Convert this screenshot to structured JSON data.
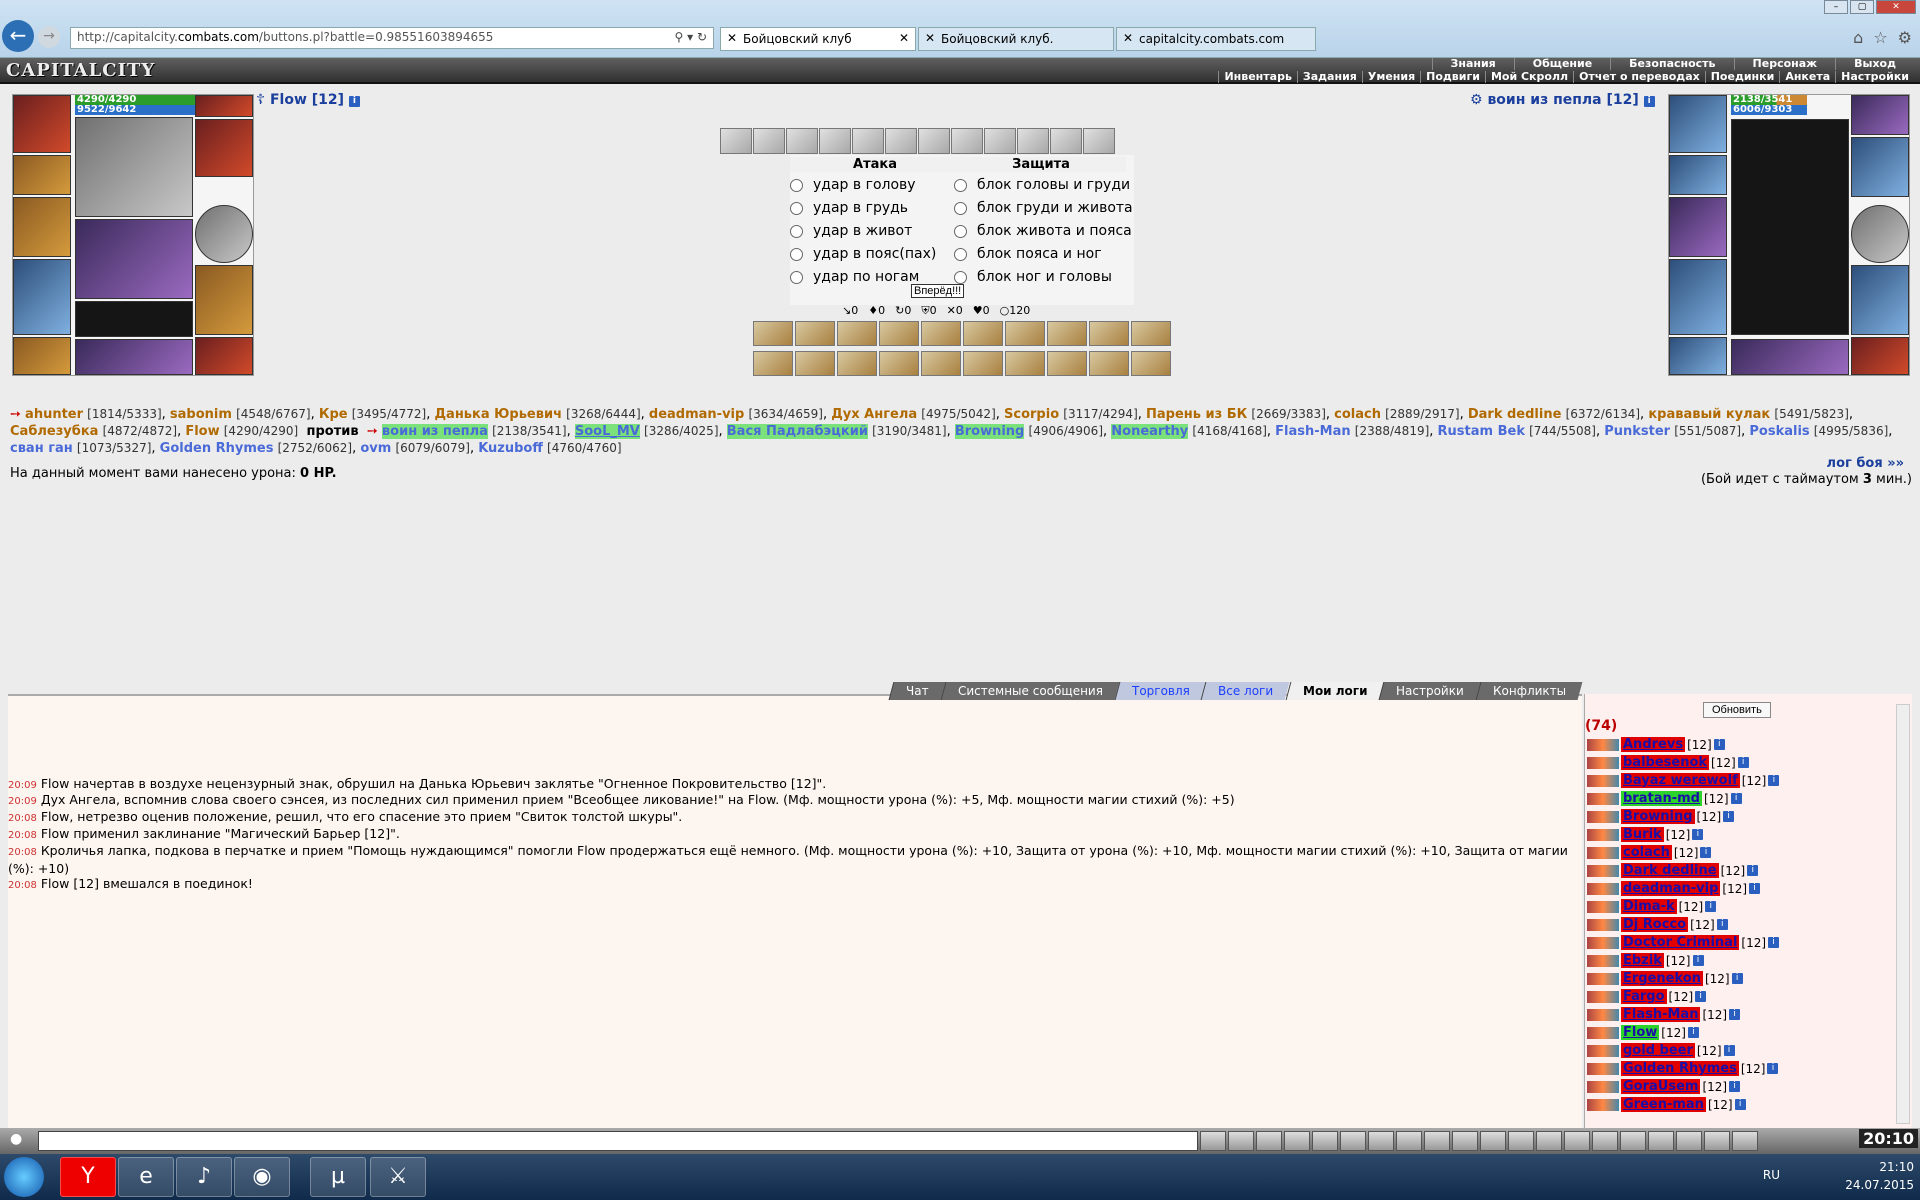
{
  "browser": {
    "url_prefix": "http://capitalcity.",
    "url_domain": "combats.com",
    "url_path": "/buttons.pl?battle=0.98551603894655",
    "tabs": [
      {
        "label": "Бойцовский клуб",
        "active": true
      },
      {
        "label": "Бойцовский клуб.",
        "active": false
      },
      {
        "label": "capitalcity.combats.com",
        "active": false
      }
    ]
  },
  "game": {
    "logo": "CAPITALCITY",
    "menu_top": [
      "Знания",
      "Общение",
      "Безопасность",
      "Персонаж",
      "Выход"
    ],
    "menu_bottom": [
      "Инвентарь",
      "Задания",
      "Умения",
      "Подвиги",
      "Мой Скролл",
      "Отчет о переводах",
      "Поединки",
      "Анкета",
      "Настройки"
    ],
    "player": {
      "name": "Flow",
      "level": "[12]",
      "hp": "4290/4290",
      "mp": "9522/9642"
    },
    "opponent": {
      "name": "воин из пепла",
      "level": "[12]",
      "hp": "2138/3541",
      "mp": "6006/9303"
    },
    "attack_title": "Атака",
    "defense_title": "Защита",
    "attacks": [
      "удар в голову",
      "удар в грудь",
      "удар в живот",
      "удар в пояс(пах)",
      "удар по ногам"
    ],
    "defenses": [
      "блок головы и груди",
      "блок груди и живота",
      "блок живота и пояса",
      "блок пояса и ног",
      "блок ног и головы"
    ],
    "forward_button": "Вперёд!!!",
    "stats": [
      "0",
      "0",
      "0",
      "0",
      "0",
      "0",
      "120"
    ],
    "team1": [
      {
        "name": "ahunter",
        "stat": "[1814/5333]"
      },
      {
        "name": "sabonim",
        "stat": "[4548/6767]"
      },
      {
        "name": "Кре",
        "stat": "[3495/4772]"
      },
      {
        "name": "Данька Юрьевич",
        "stat": "[3268/6444]"
      },
      {
        "name": "deadman-vip",
        "stat": "[3634/4659]"
      },
      {
        "name": "Дух Ангела",
        "stat": "[4975/5042]"
      },
      {
        "name": "Scorpio",
        "stat": "[3117/4294]"
      },
      {
        "name": "Парень из БК",
        "stat": "[2669/3383]"
      },
      {
        "name": "colach",
        "stat": "[2889/2917]"
      },
      {
        "name": "Dark dedline",
        "stat": "[6372/6134]"
      },
      {
        "name": "крававый кулак",
        "stat": "[5491/5823]"
      },
      {
        "name": "Саблезубка",
        "stat": "[4872/4872]"
      },
      {
        "name": "Flow",
        "stat": "[4290/4290]"
      }
    ],
    "versus": "против",
    "team2": [
      {
        "name": "воин из пепла",
        "stat": "[2138/3541]"
      },
      {
        "name": "SooL_MV",
        "stat": "[3286/4025]"
      },
      {
        "name": "Вася Падлабэцкий",
        "stat": "[3190/3481]"
      },
      {
        "name": "Browning",
        "stat": "[4906/4906]"
      },
      {
        "name": "Nonearthy",
        "stat": "[4168/4168]"
      },
      {
        "name": "Flash-Man",
        "stat": "[2388/4819]"
      },
      {
        "name": "Rustam Bek",
        "stat": "[744/5508]"
      },
      {
        "name": "Punkster",
        "stat": "[551/5087]"
      },
      {
        "name": "Poskalis",
        "stat": "[4995/5836]"
      },
      {
        "name": "сван ган",
        "stat": "[1073/5327]"
      },
      {
        "name": "Golden Rhymes",
        "stat": "[2752/6062]"
      },
      {
        "name": "ovm",
        "stat": "[6079/6079]"
      },
      {
        "name": "Kuzuboff",
        "stat": "[4760/4760]"
      }
    ],
    "damage_text": "На данный момент вами нанесено урона:",
    "damage_value": "0 HP.",
    "log_link": "лог боя »»",
    "timeout_pre": "(Бой идет с таймаутом ",
    "timeout_val": "3",
    "timeout_post": " мин.)"
  },
  "chat": {
    "tabs": [
      "Чат",
      "Системные сообщения",
      "Торговля",
      "Все логи",
      "Мои логи",
      "Настройки",
      "Конфликты"
    ],
    "messages": [
      {
        "time": "20:09",
        "text": "Flow начертав в воздухе нецензурный знак, обрушил на Данька Юрьевич заклятье \"Огненное Покровительство [12]\"."
      },
      {
        "time": "20:09",
        "text": "Дух Ангела, вспомнив слова своего сэнсея, из последних сил применил прием \"Всеобщее ликование!\" на Flow. (Мф. мощности урона (%): +5, Мф. мощности магии стихий (%): +5)"
      },
      {
        "time": "20:08",
        "text": "Flow, нетрезво оценив положение, решил, что его спасение это прием \"Свиток толстой шкуры\"."
      },
      {
        "time": "20:08",
        "text": "Flow применил заклинание \"Магический Барьер [12]\"."
      },
      {
        "time": "20:08",
        "text": "Кроличья лапка, подкова в перчатке и прием \"Помощь нуждающимся\" помогли Flow продержаться ещё немного. (Мф. мощности урона (%): +10, Защита от урона (%): +10, Мф. мощности магии стихий (%): +10, Защита от магии (%): +10)"
      },
      {
        "time": "20:08",
        "text": "Flow [12] вмешался в поединок!"
      }
    ],
    "refresh": "Обновить",
    "count": "(74)",
    "players": [
      {
        "name": "Andrevs",
        "level": "[12]"
      },
      {
        "name": "balbesenok",
        "level": "[12]"
      },
      {
        "name": "Bayaz werewolf",
        "level": "[12]"
      },
      {
        "name": "bratan-md",
        "level": "[12]"
      },
      {
        "name": "Browning",
        "level": "[12]"
      },
      {
        "name": "Burik",
        "level": "[12]"
      },
      {
        "name": "colach",
        "level": "[12]"
      },
      {
        "name": "Dark dedline",
        "level": "[12]"
      },
      {
        "name": "deadman-vip",
        "level": "[12]"
      },
      {
        "name": "Dima-k",
        "level": "[12]"
      },
      {
        "name": "Dj Rocco",
        "level": "[12]"
      },
      {
        "name": "Doctor Criminal",
        "level": "[12]"
      },
      {
        "name": "Ebzik",
        "level": "[12]"
      },
      {
        "name": "Ergenekon",
        "level": "[12]"
      },
      {
        "name": "Fargo",
        "level": "[12]"
      },
      {
        "name": "Flash-Man",
        "level": "[12]"
      },
      {
        "name": "Flow",
        "level": "[12]"
      },
      {
        "name": "gold beer",
        "level": "[12]"
      },
      {
        "name": "Golden Rhymes",
        "level": "[12]"
      },
      {
        "name": "GoraUsem",
        "level": "[12]"
      },
      {
        "name": "Green-man",
        "level": "[12]"
      }
    ]
  },
  "bottom": {
    "clock": "20:10"
  },
  "taskbar": {
    "lang": "RU",
    "time": "21:10",
    "date": "24.07.2015"
  }
}
